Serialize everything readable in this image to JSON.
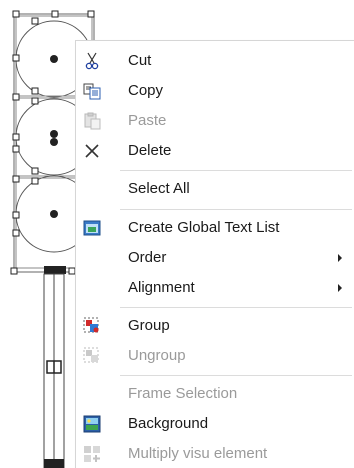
{
  "context_menu": {
    "items": [
      {
        "label": "Cut",
        "icon": "scissors-icon",
        "enabled": true
      },
      {
        "label": "Copy",
        "icon": "copy-icon",
        "enabled": true
      },
      {
        "label": "Paste",
        "icon": "paste-icon",
        "enabled": false
      },
      {
        "label": "Delete",
        "icon": "delete-x-icon",
        "enabled": true
      },
      {
        "label": "Select All",
        "icon": "",
        "enabled": true
      },
      {
        "label": "Create Global Text List",
        "icon": "text-list-icon",
        "enabled": true
      },
      {
        "label": "Order",
        "icon": "",
        "enabled": true,
        "submenu": true
      },
      {
        "label": "Alignment",
        "icon": "",
        "enabled": true,
        "submenu": true
      },
      {
        "label": "Group",
        "icon": "group-icon",
        "enabled": true
      },
      {
        "label": "Ungroup",
        "icon": "ungroup-icon",
        "enabled": false
      },
      {
        "label": "Frame Selection",
        "icon": "",
        "enabled": false
      },
      {
        "label": "Background",
        "icon": "background-icon",
        "enabled": true
      },
      {
        "label": "Multiply visu element",
        "icon": "multiply-icon",
        "enabled": false
      }
    ]
  },
  "colors": {
    "text": "#1a1a1a",
    "disabled_text": "#9a9a9a",
    "separator": "#dcdcdc",
    "handle_fill": "#333333",
    "outline": "#555555"
  }
}
